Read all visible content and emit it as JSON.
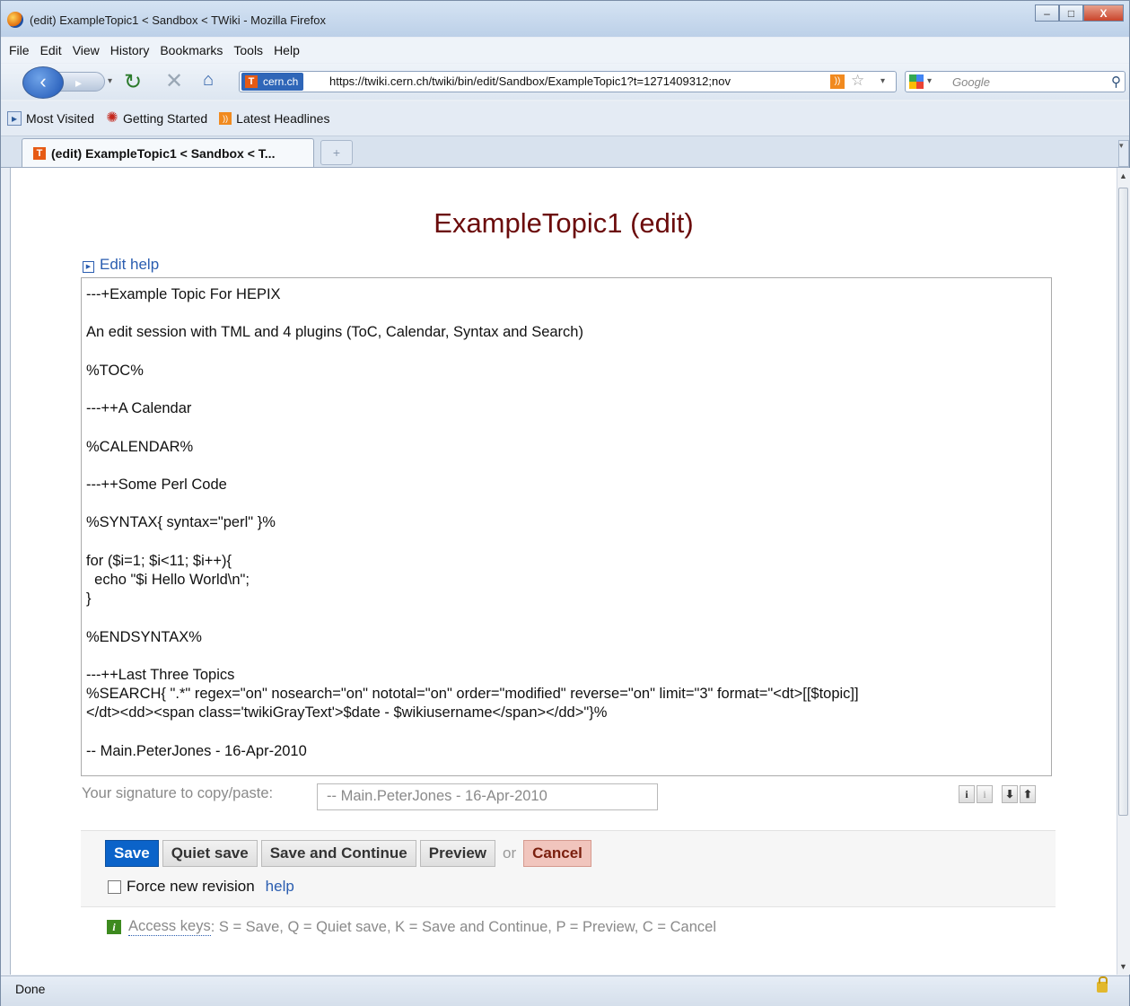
{
  "window": {
    "title": "(edit) ExampleTopic1 < Sandbox < TWiki - Mozilla Firefox",
    "minimize": "–",
    "maximize": "□",
    "close": "X"
  },
  "menu": [
    "File",
    "Edit",
    "View",
    "History",
    "Bookmarks",
    "Tools",
    "Help"
  ],
  "nav": {
    "site_identity": "cern.ch",
    "url": "https://twiki.cern.ch/twiki/bin/edit/Sandbox/ExampleTopic1?t=1271409312;nov",
    "search_placeholder": "Google"
  },
  "bookmarks": [
    "Most Visited",
    "Getting Started",
    "Latest Headlines"
  ],
  "tab": {
    "label": "(edit) ExampleTopic1 < Sandbox < T...",
    "new_tab": "+"
  },
  "page": {
    "title": "ExampleTopic1 (edit)",
    "edit_help": "Edit help",
    "editor_text": "---+Example Topic For HEPIX\n\nAn edit session with TML and 4 plugins (ToC, Calendar, Syntax and Search)\n\n%TOC%\n\n---++A Calendar\n\n%CALENDAR%\n\n---++Some Perl Code\n\n%SYNTAX{ syntax=\"perl\" }%\n\nfor ($i=1; $i<11; $i++){\n  echo \"$i Hello World\\n\";\n}\n\n%ENDSYNTAX%\n\n---++Last Three Topics\n%SEARCH{ \".*\" regex=\"on\" nosearch=\"on\" nototal=\"on\" order=\"modified\" reverse=\"on\" limit=\"3\" format=\"<dt>[[$topic]]\n</dt><dd><span class='twikiGrayText'>$date - $wikiusername</span></dd>\"}%\n\n-- Main.PeterJones - 16-Apr-2010",
    "signature_label": "Your signature to copy/paste:",
    "signature_value": "-- Main.PeterJones - 16-Apr-2010",
    "buttons": {
      "save": "Save",
      "quiet_save": "Quiet save",
      "save_continue": "Save and Continue",
      "preview": "Preview",
      "or": "or",
      "cancel": "Cancel"
    },
    "force_revision": "Force new revision",
    "help": "help",
    "access_keys_label": "Access keys",
    "access_keys_text": ": S = Save, Q = Quiet save, K = Save and Continue, P = Preview, C = Cancel"
  },
  "status": "Done"
}
